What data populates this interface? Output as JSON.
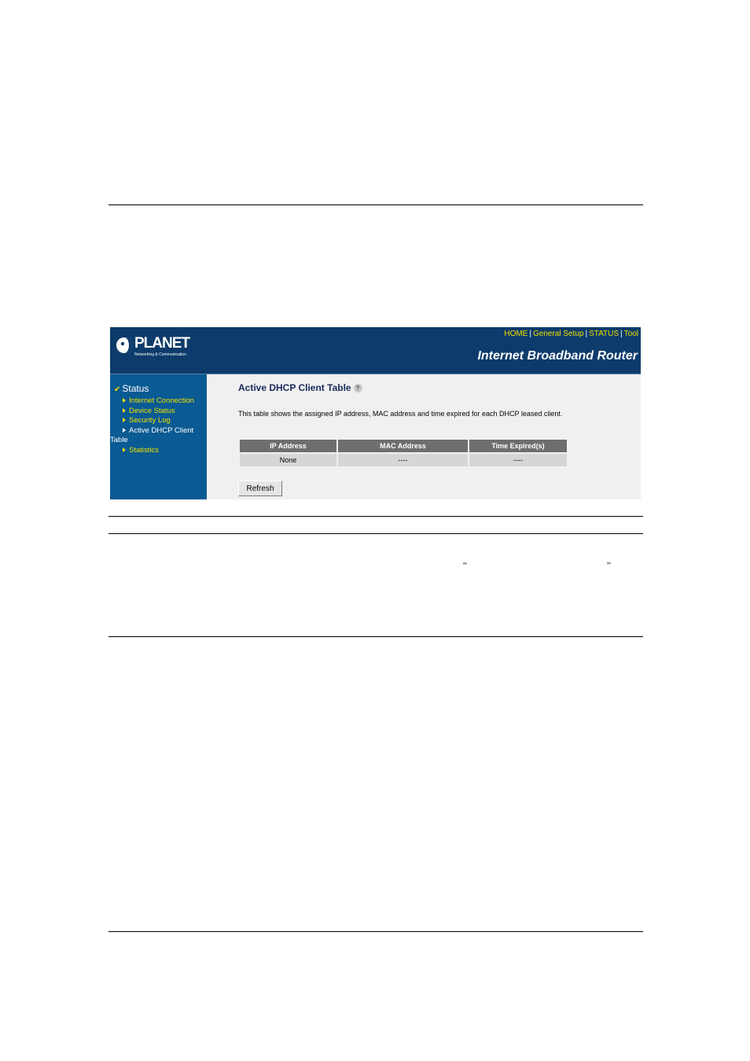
{
  "router": {
    "logo_text": "PLANET",
    "logo_subtitle": "Networking & Communication",
    "nav": [
      {
        "label": "HOME"
      },
      {
        "label": "General Setup"
      },
      {
        "label": "STATUS"
      },
      {
        "label": "Tool"
      }
    ],
    "nav_separator": "|",
    "product_title": "Internet Broadband Router"
  },
  "sidebar": {
    "title": "Status",
    "items": [
      {
        "label": "Internet Connection"
      },
      {
        "label": "Device Status"
      },
      {
        "label": "Security Log"
      },
      {
        "label": "Active DHCP Client",
        "continuation": "Table"
      },
      {
        "label": "Statistics"
      }
    ]
  },
  "main": {
    "title": "Active DHCP Client Table",
    "description": "This table shows the assigned IP address, MAC address and time expired for each DHCP leased client.",
    "table": {
      "headers": [
        "IP Address",
        "MAC Address",
        "Time Expired(s)"
      ],
      "rows": [
        [
          "None",
          "----",
          "----"
        ]
      ]
    },
    "refresh_label": "Refresh"
  },
  "document": {
    "open_quote": "“",
    "close_quote": "”"
  },
  "colors": {
    "header_bg": "#0d3b6b",
    "sidebar_bg": "#0a5a93",
    "link_yellow": "#f0e000",
    "table_header_bg": "#6e6e6e",
    "table_cell_bg": "#d6d6d6"
  }
}
